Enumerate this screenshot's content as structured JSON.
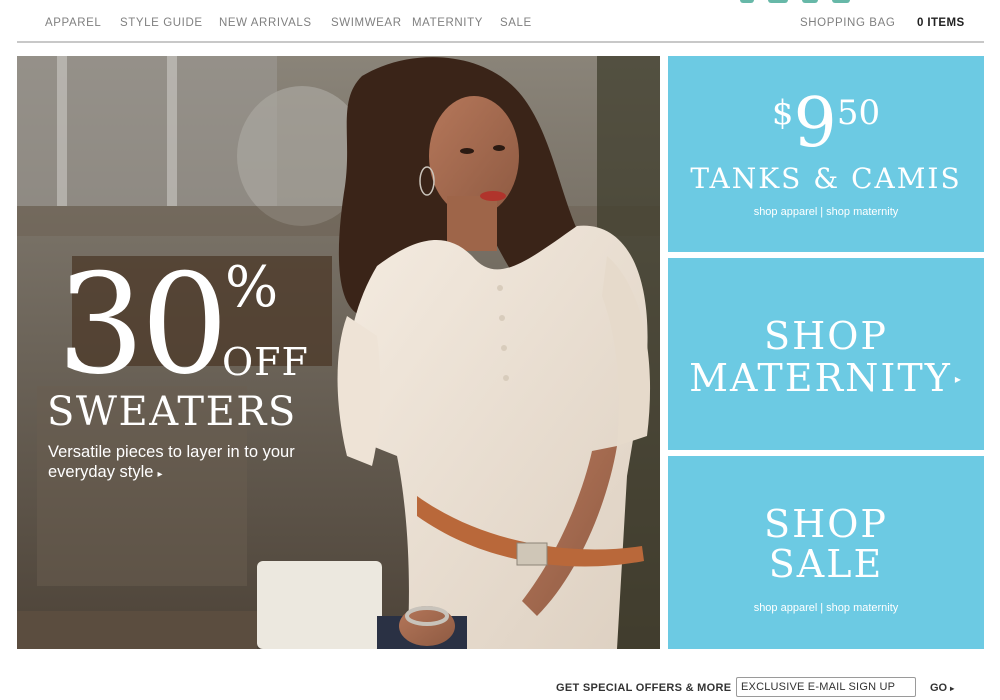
{
  "nav": {
    "items": [
      "APPAREL",
      "STYLE GUIDE",
      "NEW ARRIVALS",
      "SWIMWEAR",
      "MATERNITY",
      "SALE"
    ],
    "shopping_bag": "SHOPPING BAG",
    "bag_count": "0 ITEMS"
  },
  "hero": {
    "discount_number": "30",
    "percent_sign": "%",
    "off_label": "OFF",
    "product": "SWEATERS",
    "tagline": "Versatile pieces to layer in to your everyday style",
    "tagline_arrow": "▸"
  },
  "tile_tanks": {
    "currency": "$",
    "price_whole": "9",
    "price_cents": "50",
    "title": "TANKS & CAMIS",
    "link_apparel": "shop apparel",
    "separator": "|",
    "link_maternity": "shop maternity"
  },
  "tile_maternity": {
    "line1": "SHOP",
    "line2": "MATERNITY",
    "arrow": "▸"
  },
  "tile_sale": {
    "line1": "SHOP",
    "line2": "SALE",
    "link_apparel": "shop apparel",
    "separator": "|",
    "link_maternity": "shop maternity"
  },
  "footer": {
    "offers_label": "GET SPECIAL OFFERS & MORE",
    "email_value": "EXCLUSIVE E-MAIL SIGN UP",
    "go_label": "GO",
    "go_arrow": "▸"
  },
  "colors": {
    "tile_blue": "#6ccae3",
    "nav_text": "#808080",
    "logo_green": "#67b8a8"
  }
}
